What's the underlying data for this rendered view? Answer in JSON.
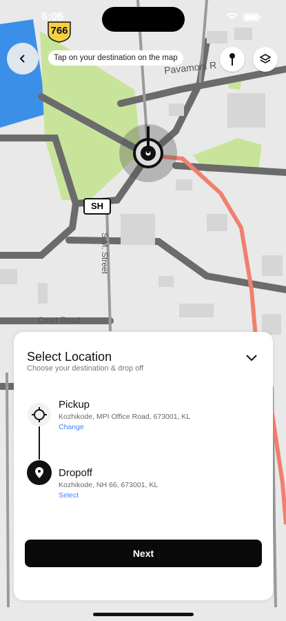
{
  "status_bar": {
    "time": "6:06"
  },
  "map": {
    "route_shield": "766",
    "labels": {
      "road_top": "Pavamoni R",
      "road_sm": "S.M. Street",
      "road_court": "Court Road",
      "sh_marker": "SH"
    },
    "colors": {
      "park": "#c8e49a",
      "water": "#3b8fe8",
      "route": "#f0806d",
      "road": "#6b6b6b"
    }
  },
  "header": {
    "hint": "Tap on your destination on the map",
    "icons": [
      "back-arrow-icon",
      "pin-icon",
      "layers-icon"
    ]
  },
  "sheet": {
    "title": "Select Location",
    "subtitle": "Choose your destination & drop off",
    "pickup": {
      "title": "Pickup",
      "address": "Kozhikode, MPI Office Road, 673001, KL",
      "action": "Change"
    },
    "dropoff": {
      "title": "Dropoff",
      "address": "Kozhikode, NH 66, 673001, KL",
      "action": "Select"
    },
    "next_label": "Next"
  }
}
